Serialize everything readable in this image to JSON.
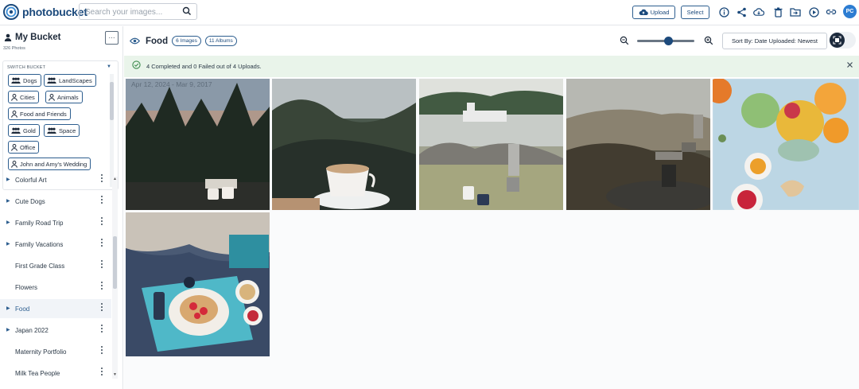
{
  "brand": {
    "name": "photobucket"
  },
  "search": {
    "placeholder": "Search your images..."
  },
  "toolbar": {
    "upload_label": "Upload",
    "select_label": "Select",
    "icons": [
      "info-icon",
      "share-icon",
      "cloud-download-icon",
      "trash-icon",
      "move-to-folder-icon",
      "slideshow-play-icon",
      "link-icon"
    ],
    "avatar_initials": "PC"
  },
  "sidebar": {
    "bucket_title": "My Bucket",
    "photo_count": "326 Photos",
    "more_label": "···",
    "switch_bucket_label": "SWITCH BUCKET",
    "buckets": [
      {
        "label": "Dogs",
        "icon": "group-icon"
      },
      {
        "label": "LandScapes",
        "icon": "group-icon"
      },
      {
        "label": "Cities",
        "icon": "person-icon"
      },
      {
        "label": "Animals",
        "icon": "person-icon"
      },
      {
        "label": "Food and Friends",
        "icon": "person-icon"
      },
      {
        "label": "Gold",
        "icon": "group-icon"
      },
      {
        "label": "Space",
        "icon": "group-icon"
      },
      {
        "label": "Office",
        "icon": "person-icon"
      },
      {
        "label": "John and Amy's Wedding",
        "icon": "person-icon"
      }
    ],
    "albums": [
      {
        "label": "Colorful Art",
        "expandable": true,
        "active": false
      },
      {
        "label": "Cute Dogs",
        "expandable": true,
        "active": false
      },
      {
        "label": "Family Road Trip",
        "expandable": true,
        "active": false
      },
      {
        "label": "Family Vacations",
        "expandable": true,
        "active": false
      },
      {
        "label": "First Grade Class",
        "expandable": false,
        "active": false
      },
      {
        "label": "Flowers",
        "expandable": false,
        "active": false
      },
      {
        "label": "Food",
        "expandable": true,
        "active": true
      },
      {
        "label": "Japan 2022",
        "expandable": true,
        "active": false
      },
      {
        "label": "Maternity Portfolio",
        "expandable": false,
        "active": false
      },
      {
        "label": "Milk Tea People",
        "expandable": false,
        "active": false
      }
    ]
  },
  "main": {
    "album_title": "Food",
    "images_pill": "6 Images",
    "albums_pill": "11 Albums",
    "sort_label": "Sort By: Date Uploaded: Newest",
    "zoom_level": 0.55
  },
  "alert": {
    "message": "4 Completed and 0 Failed out of 4 Uploads."
  },
  "gallery": {
    "date_range": "Apr 12, 2024 - Mar 9, 2017",
    "photos": [
      {
        "name": "photo-coffee-cups-forest"
      },
      {
        "name": "photo-coffee-mountain-view"
      },
      {
        "name": "photo-camping-coffee-lake"
      },
      {
        "name": "photo-camp-stove-coffee"
      },
      {
        "name": "photo-smoothie-bowls"
      },
      {
        "name": "photo-breakfast-tray-bed"
      }
    ]
  },
  "colors": {
    "brand": "#1c4a7c",
    "accent": "#2d5e8f",
    "alert_bg": "#e9f4ea",
    "avatar_bg": "#2d7dd2"
  }
}
